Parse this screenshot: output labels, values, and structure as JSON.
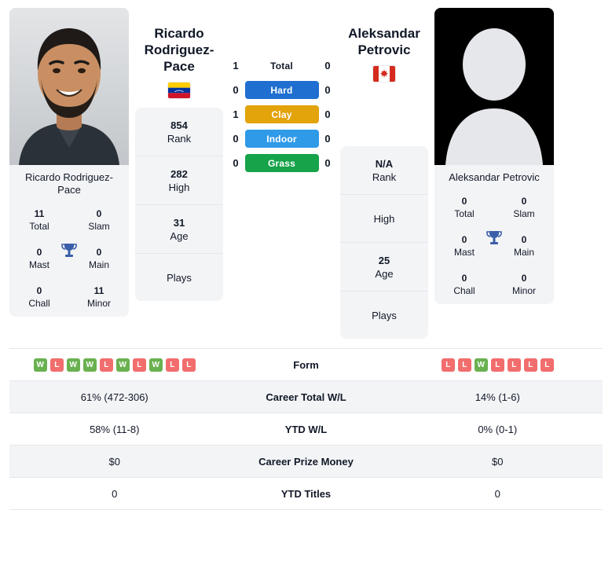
{
  "players": {
    "left": {
      "name_top": "Ricardo Rodriguez-Pace",
      "name_line1": "Ricardo",
      "name_line2": "Rodriguez-Pace",
      "name_under": "Ricardo Rodriguez-Pace",
      "country": "Venezuela",
      "flag": "venezuela-flag",
      "stats": [
        {
          "value": "11",
          "label": "Total"
        },
        {
          "value": "0",
          "label": "Slam"
        },
        {
          "value": "0",
          "label": "Mast"
        },
        {
          "value": "0",
          "label": "Main"
        },
        {
          "value": "0",
          "label": "Chall"
        },
        {
          "value": "11",
          "label": "Minor"
        }
      ]
    },
    "right": {
      "name_line1": "Aleksandar",
      "name_line2": "Petrovic",
      "name_under": "Aleksandar Petrovic",
      "country": "Canada",
      "flag": "canada-flag",
      "stats": [
        {
          "value": "0",
          "label": "Total"
        },
        {
          "value": "0",
          "label": "Slam"
        },
        {
          "value": "0",
          "label": "Mast"
        },
        {
          "value": "0",
          "label": "Main"
        },
        {
          "value": "0",
          "label": "Chall"
        },
        {
          "value": "0",
          "label": "Minor"
        }
      ]
    }
  },
  "meta_left": [
    {
      "value": "854",
      "label": "Rank"
    },
    {
      "value": "282",
      "label": "High"
    },
    {
      "value": "31",
      "label": "Age"
    },
    {
      "value": "",
      "label": "Plays"
    }
  ],
  "meta_right": [
    {
      "value": "N/A",
      "label": "Rank"
    },
    {
      "value": "",
      "label": "High"
    },
    {
      "value": "25",
      "label": "Age"
    },
    {
      "value": "",
      "label": "Plays"
    }
  ],
  "surfaces": [
    {
      "label": "Total",
      "left": "1",
      "right": "0",
      "color": "transparent"
    },
    {
      "label": "Hard",
      "left": "0",
      "right": "0",
      "color": "#1f6fd0"
    },
    {
      "label": "Clay",
      "left": "1",
      "right": "0",
      "color": "#e2a30b"
    },
    {
      "label": "Indoor",
      "left": "0",
      "right": "0",
      "color": "#2f9ae8"
    },
    {
      "label": "Grass",
      "left": "0",
      "right": "0",
      "color": "#17a34a"
    }
  ],
  "form": {
    "label": "Form",
    "left": [
      "W",
      "L",
      "W",
      "W",
      "L",
      "W",
      "L",
      "W",
      "L",
      "L"
    ],
    "right": [
      "L",
      "L",
      "W",
      "L",
      "L",
      "L",
      "L"
    ]
  },
  "rows": [
    {
      "label": "Career Total W/L",
      "left": "61% (472-306)",
      "right": "14% (1-6)"
    },
    {
      "label": "YTD W/L",
      "left": "58% (11-8)",
      "right": "0% (0-1)"
    },
    {
      "label": "Career Prize Money",
      "left": "$0",
      "right": "$0"
    },
    {
      "label": "YTD Titles",
      "left": "0",
      "right": "0"
    }
  ],
  "colors": {
    "win": "#6ab150",
    "loss": "#f26d6d",
    "hard": "#1f6fd0",
    "clay": "#e2a30b",
    "indoor": "#2f9ae8",
    "grass": "#17a34a",
    "panel": "#f3f4f6"
  }
}
